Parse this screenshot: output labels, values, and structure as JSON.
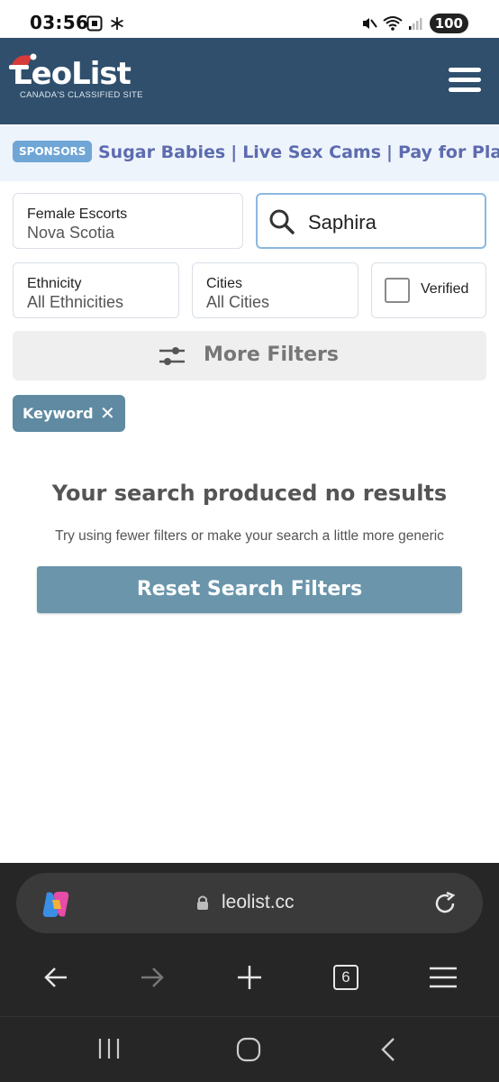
{
  "status_bar": {
    "time": "03:56",
    "battery": "100"
  },
  "header": {
    "logo_text": "LeoList",
    "logo_subtitle": "CANADA'S CLASSIFIED SITE"
  },
  "sponsors": {
    "badge": "SPONSORS",
    "links": [
      "Sugar Babies",
      "Live Sex Cams",
      "Pay for Play"
    ],
    "separator": "|"
  },
  "filters": {
    "category": {
      "label": "Female Escorts",
      "value": "Nova Scotia"
    },
    "search": {
      "value": "Saphira"
    },
    "ethnicity": {
      "label": "Ethnicity",
      "value": "All Ethnicities"
    },
    "cities": {
      "label": "Cities",
      "value": "All Cities"
    },
    "verified": {
      "label": "Verified",
      "checked": false
    },
    "more_filters": "More Filters",
    "active_chip": "Keyword"
  },
  "results": {
    "title": "Your search produced no results",
    "hint": "Try using fewer filters or make your search a little more generic",
    "reset_button": "Reset Search Filters"
  },
  "browser": {
    "url": "leolist.cc",
    "tab_count": "6"
  },
  "colors": {
    "header_bg": "#2f4f6d",
    "sponsor_link": "#5d6bb0",
    "chip_bg": "#5f8aa2",
    "reset_bg": "#6a95ab"
  }
}
